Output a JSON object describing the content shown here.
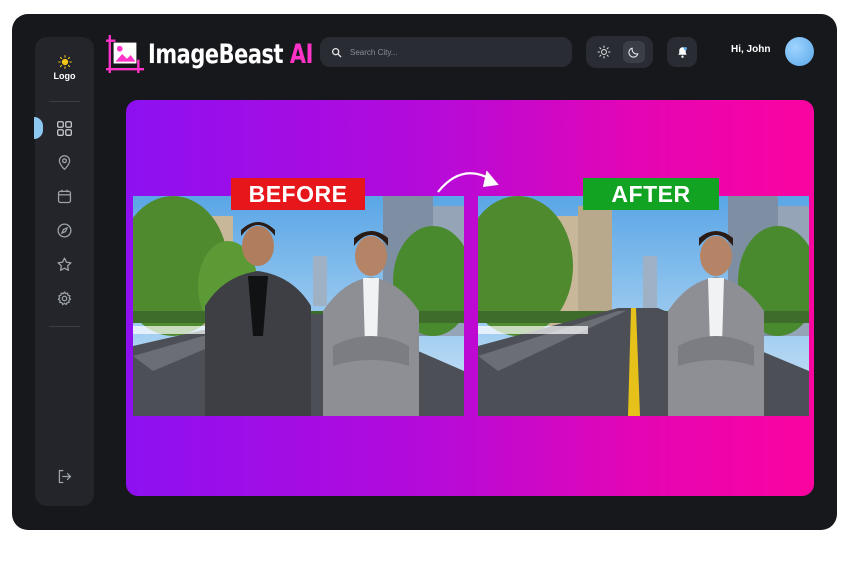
{
  "sidebar": {
    "logo_label": "Logo",
    "active_index": 0,
    "items": [
      {
        "icon": "grid-icon"
      },
      {
        "icon": "location-pin-icon"
      },
      {
        "icon": "calendar-icon"
      },
      {
        "icon": "compass-icon"
      },
      {
        "icon": "star-icon"
      },
      {
        "icon": "gear-icon"
      }
    ],
    "logout_icon": "logout-icon"
  },
  "header": {
    "brand_part1": "ImageBeast",
    "brand_part2": " AI",
    "search_placeholder": "Search City...",
    "theme": {
      "options": [
        "light",
        "dark"
      ],
      "selected": "dark"
    },
    "greeting": "Hi, John"
  },
  "banner": {
    "before_label": "BEFORE",
    "after_label": "AFTER"
  },
  "colors": {
    "brand_accent": "#ff33c8",
    "before_red": "#e6161b",
    "after_green": "#13a323",
    "banner_start": "#8d10f1",
    "banner_end": "#fb04a0"
  }
}
